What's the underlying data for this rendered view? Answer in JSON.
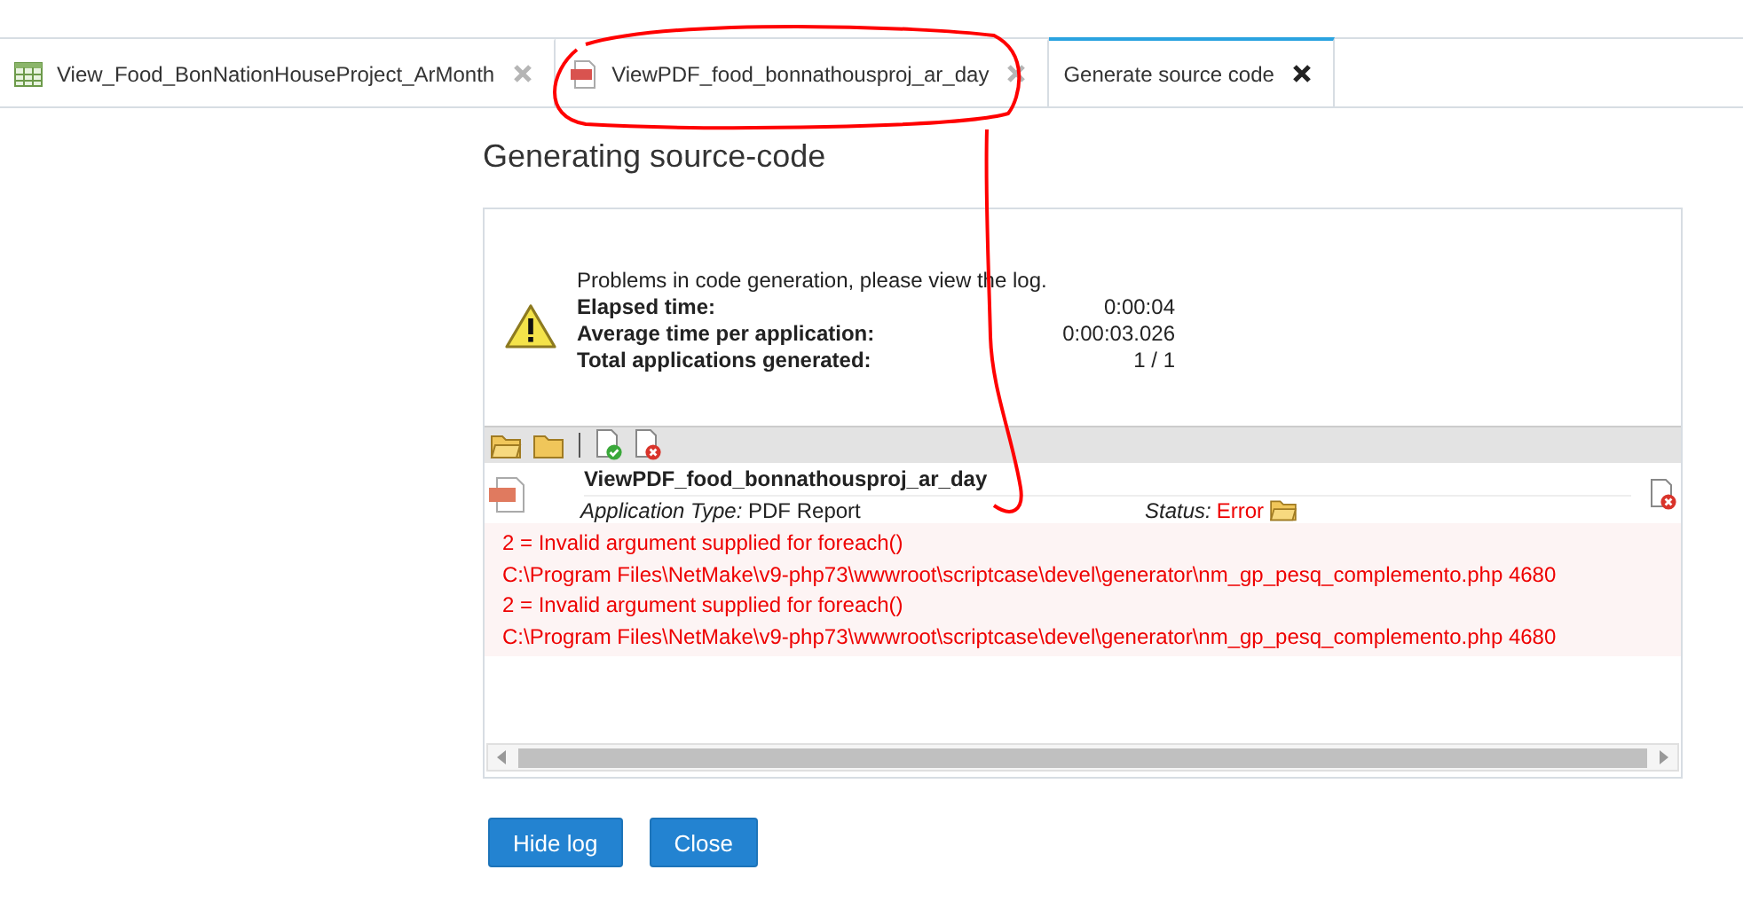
{
  "tabs": [
    {
      "label": "View_Food_BonNationHouseProject_ArMonth",
      "kind": "grid",
      "selected": false
    },
    {
      "label": "ViewPDF_food_bonnathousproj_ar_day",
      "kind": "pdf",
      "selected": false
    },
    {
      "label": "Generate source code",
      "kind": "none",
      "selected": true
    }
  ],
  "heading": "Generating source-code",
  "summary": {
    "message": "Problems in code generation, please view the log.",
    "stats": [
      {
        "label": "Elapsed time:",
        "value": "0:00:04"
      },
      {
        "label": "Average time per application:",
        "value": "0:00:03.026"
      },
      {
        "label": "Total applications generated:",
        "value": "1 / 1"
      }
    ]
  },
  "log": {
    "app_name": "ViewPDF_food_bonnathousproj_ar_day",
    "type_label": "Application Type:",
    "type_value": "PDF Report",
    "status_label": "Status:",
    "status_value": "Error",
    "errors": [
      "2 = Invalid argument supplied for foreach()",
      "C:\\Program Files\\NetMake\\v9-php73\\wwwroot\\scriptcase\\devel\\generator\\nm_gp_pesq_complemento.php 4680",
      "2 = Invalid argument supplied for foreach()",
      "C:\\Program Files\\NetMake\\v9-php73\\wwwroot\\scriptcase\\devel\\generator\\nm_gp_pesq_complemento.php 4680"
    ]
  },
  "buttons": [
    "Hide log",
    "Close"
  ]
}
